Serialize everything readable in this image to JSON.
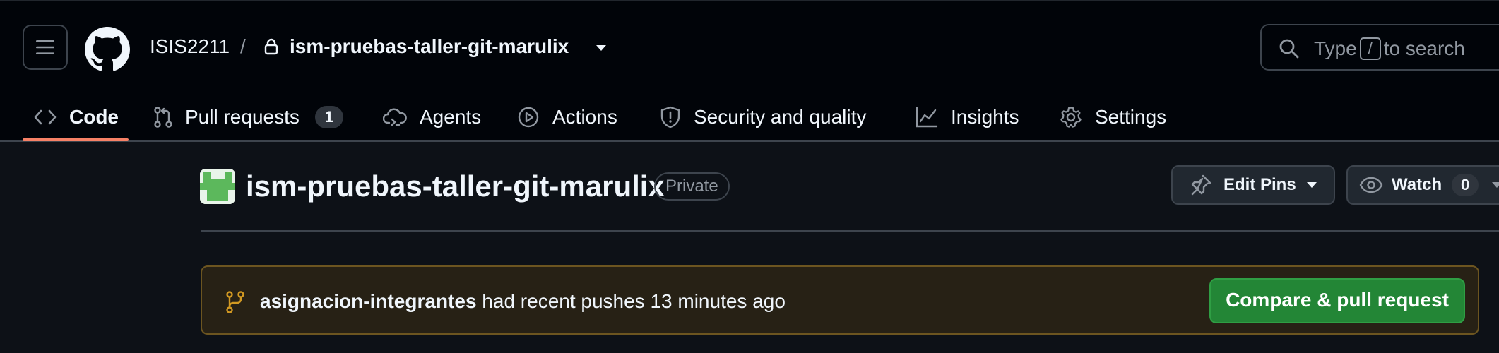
{
  "header": {
    "owner": "ISIS2211",
    "separator": "/",
    "repo": "ism-pruebas-taller-git-marulix",
    "search": {
      "prefix": "Type",
      "key": "/",
      "suffix": "to search"
    }
  },
  "tabs": [
    {
      "label": "Code",
      "icon": "code-icon",
      "active": true
    },
    {
      "label": "Pull requests",
      "icon": "git-pull-request-icon",
      "counter": "1"
    },
    {
      "label": "Agents",
      "icon": "agent-cloud-icon"
    },
    {
      "label": "Actions",
      "icon": "play-icon"
    },
    {
      "label": "Security and quality",
      "icon": "shield-icon"
    },
    {
      "label": "Insights",
      "icon": "graph-icon"
    },
    {
      "label": "Settings",
      "icon": "gear-icon"
    }
  ],
  "repo_header": {
    "title": "ism-pruebas-taller-git-marulix",
    "visibility": "Private",
    "edit_pins_label": "Edit Pins",
    "watch_label": "Watch",
    "watch_count": "0"
  },
  "banner": {
    "branch": "asignacion-integrantes",
    "message": "had recent pushes 13 minutes ago",
    "button_label": "Compare & pull request"
  },
  "colors": {
    "accent_underline": "#f78166",
    "primary_button": "#238636",
    "banner_border": "#6c5520",
    "branch_icon": "#d29922"
  }
}
